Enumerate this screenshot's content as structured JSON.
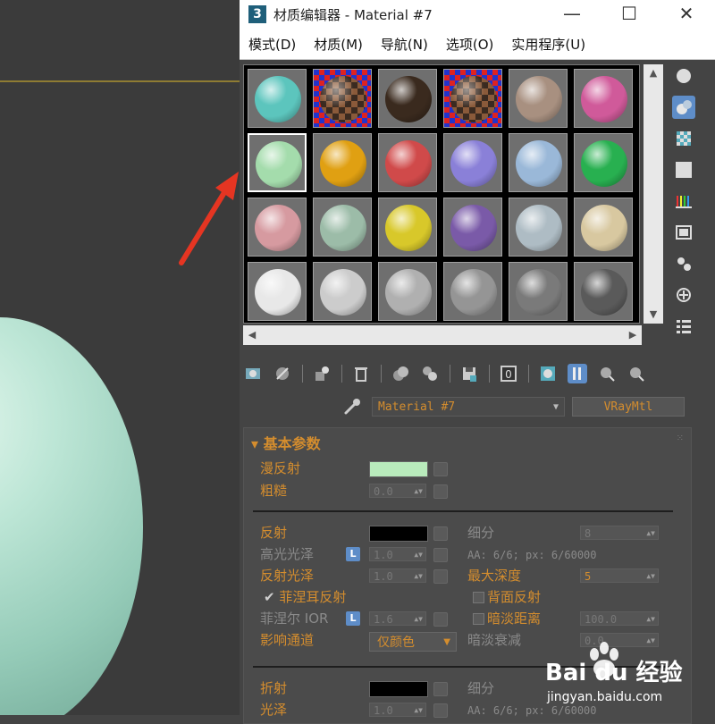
{
  "window": {
    "app_icon_text": "3",
    "title": "材质编辑器 - Material #7",
    "controls": {
      "minimize": "—",
      "maximize": "☐",
      "close": "✕"
    }
  },
  "menu": [
    "模式(D)",
    "材质(M)",
    "导航(N)",
    "选项(O)",
    "实用程序(U)"
  ],
  "slots": [
    {
      "color": "#5cc5bd"
    },
    {
      "color": "checker"
    },
    {
      "color": "#3a2a1e"
    },
    {
      "color": "checker"
    },
    {
      "color": "#a89080"
    },
    {
      "color": "#d05a9a"
    },
    {
      "color": "#a4dcac"
    },
    {
      "color": "#e0a012"
    },
    {
      "color": "#d04a4a"
    },
    {
      "color": "#8a80d8"
    },
    {
      "color": "#9ab8d8"
    },
    {
      "color": "#28b050"
    },
    {
      "color": "#d69aa0"
    },
    {
      "color": "#9cbca8"
    },
    {
      "color": "#d8c82a"
    },
    {
      "color": "#7a5aa8"
    },
    {
      "color": "#aebcc4"
    },
    {
      "color": "#d8c8a0"
    },
    {
      "color": "#e8e8e8"
    },
    {
      "color": "#cccccc"
    },
    {
      "color": "#b0b0b0"
    },
    {
      "color": "#959595"
    },
    {
      "color": "#7a7a7a"
    },
    {
      "color": "#5a5a5a"
    }
  ],
  "selected_slot": 6,
  "material": {
    "name": "Material #7",
    "type": "VRayMtl"
  },
  "rollout": {
    "title": "基本参数",
    "diffuse": {
      "label": "漫反射",
      "color": "#b9ebbc"
    },
    "roughness": {
      "label": "粗糙",
      "value": "0.0"
    },
    "reflection": {
      "label": "反射",
      "color": "#000000"
    },
    "highlight_gloss": {
      "label": "高光光泽",
      "badge": "L",
      "value": "1.0"
    },
    "refl_gloss": {
      "label": "反射光泽",
      "value": "1.0"
    },
    "fresnel": {
      "label": "菲涅耳反射",
      "checked": true
    },
    "fresnel_ior": {
      "label": "菲涅尔 IOR",
      "badge": "L",
      "value": "1.6"
    },
    "affect_channels": {
      "label": "影响通道",
      "value": "仅颜色"
    },
    "subdivs": {
      "label": "细分",
      "value": "8"
    },
    "aa_info": "AA: 6/6; px: 6/60000",
    "max_depth": {
      "label": "最大深度",
      "value": "5"
    },
    "back_side": {
      "label": "背面反射"
    },
    "dim_distance": {
      "label": "暗淡距离",
      "value": "100.0"
    },
    "dim_falloff": {
      "label": "暗淡衰减",
      "value": "0.0"
    },
    "refraction": {
      "label": "折射",
      "color": "#000000"
    },
    "refr_subdivs": {
      "label": "细分"
    },
    "refr_gloss": {
      "label": "光泽",
      "value": "1.0"
    },
    "refr_aa_info": "AA: 6/6; px: 6/60000"
  },
  "watermark": {
    "brand": "Bai du 经验",
    "url": "jingyan.baidu.com"
  }
}
